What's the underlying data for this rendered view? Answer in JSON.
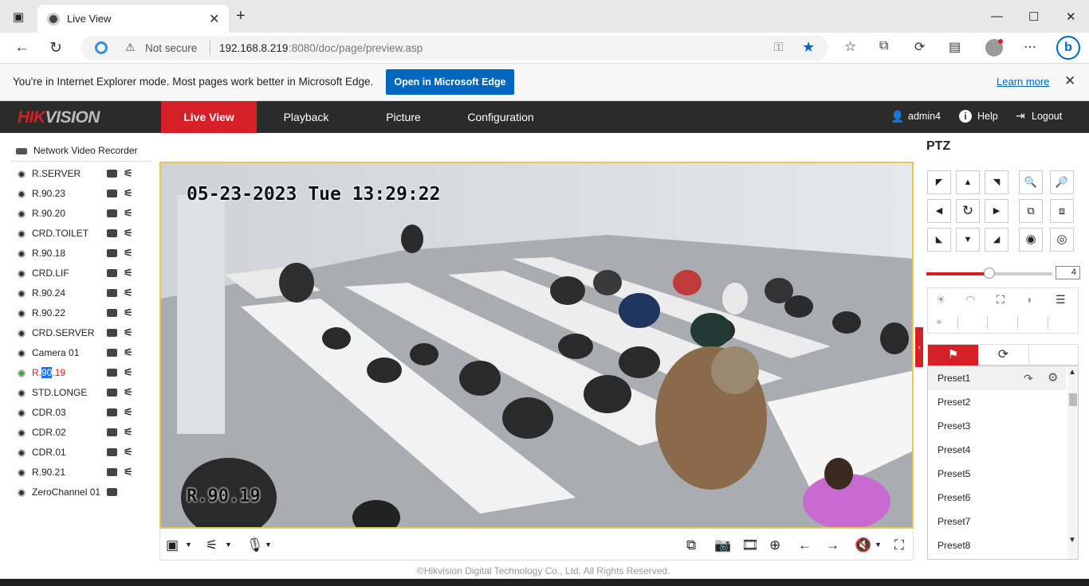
{
  "browser": {
    "tab_title": "Live View",
    "security_label": "Not secure",
    "url_host": "192.168.8.219",
    "url_rest": ":8080/doc/page/preview.asp"
  },
  "ie_banner": {
    "message": "You're in Internet Explorer mode. Most pages work better in Microsoft Edge.",
    "open_button": "Open in Microsoft Edge",
    "learn_more": "Learn more"
  },
  "hik": {
    "logo_red": "HIK",
    "logo_grey": "VISION",
    "nav": [
      "Live View",
      "Playback",
      "Picture",
      "Configuration"
    ],
    "user": "admin4",
    "help": "Help",
    "logout": "Logout"
  },
  "device": {
    "name": "Network Video Recorder",
    "channels": [
      "R.SERVER",
      "R.90.23",
      "R.90.20",
      "CRD.TOILET",
      "R.90.18",
      "CRD.LIF",
      "R.90.24",
      "R.90.22",
      "CRD.SERVER",
      "Camera 01",
      "R.90.19",
      "STD.LONGE",
      "CDR.03",
      "CDR.02",
      "CDR.01",
      "R.90.21",
      "ZeroChannel 01"
    ],
    "active_channel": {
      "pre": "R.",
      "highlight": "90",
      "post": ".19"
    }
  },
  "video": {
    "timestamp": "05-23-2023 Tue 13:29:22",
    "channel_label": "R.90.19"
  },
  "footer": {
    "copyright": "©Hikvision Digital Technology Co., Ltd. All Rights Reserved."
  },
  "ptz": {
    "title": "PTZ",
    "speed": 4,
    "speed_fraction": 0.5,
    "presets": [
      "Preset1",
      "Preset2",
      "Preset3",
      "Preset4",
      "Preset5",
      "Preset6",
      "Preset7",
      "Preset8"
    ]
  },
  "colors": {
    "accent": "#d61f26",
    "edge_blue": "#0067c0",
    "video_border": "#e8c850"
  }
}
